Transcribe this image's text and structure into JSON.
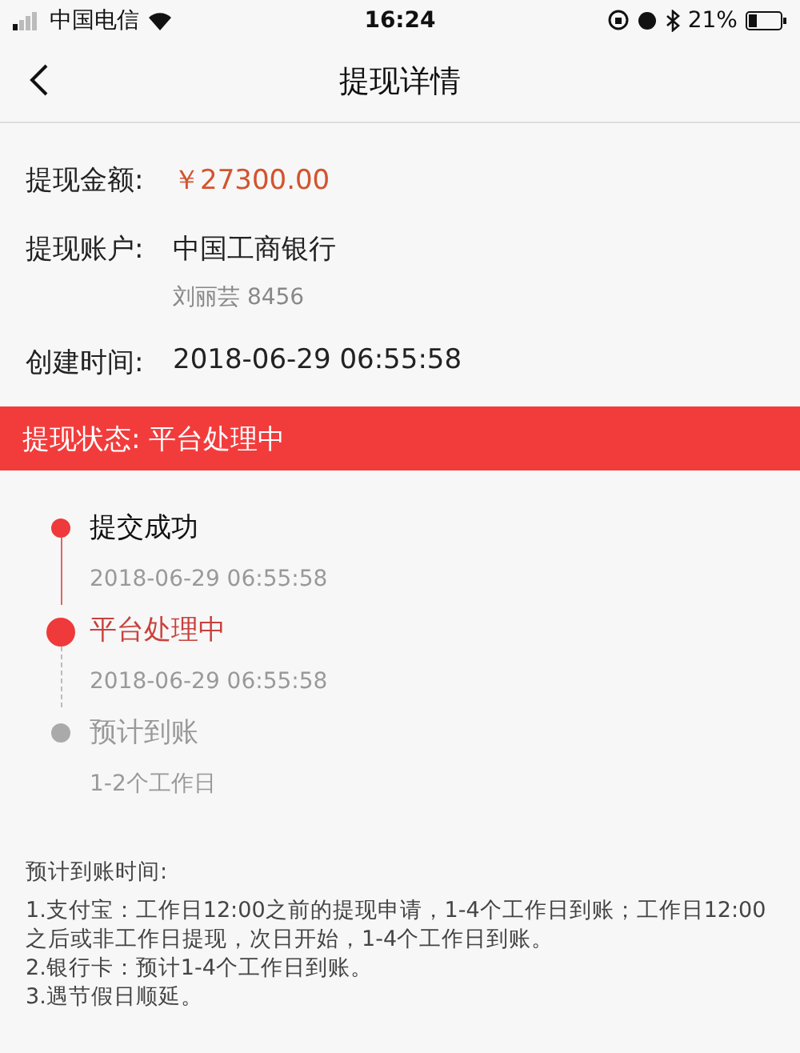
{
  "status_bar": {
    "carrier": "中国电信",
    "time": "16:24",
    "battery": "21%"
  },
  "nav": {
    "title": "提现详情"
  },
  "details": [
    {
      "label": "提现金额:",
      "value": "￥27300.00",
      "kind": "amount"
    },
    {
      "label": "提现账户:",
      "value": "中国工商银行",
      "sub": "刘丽芸 8456",
      "kind": "text"
    },
    {
      "label": "创建时间:",
      "value": "2018-06-29 06:55:58",
      "kind": "text"
    }
  ],
  "status_banner": "提现状态:  平台处理中",
  "timeline": [
    {
      "title": "提交成功",
      "time": "2018-06-29 06:55:58",
      "kind": "done"
    },
    {
      "title": "平台处理中",
      "time": "2018-06-29 06:55:58",
      "kind": "current"
    },
    {
      "title": "预计到账",
      "time": "1-2个工作日",
      "kind": "pending"
    }
  ],
  "notes": {
    "heading": "预计到账时间:",
    "items": [
      "1.支付宝：工作日12:00之前的提现申请，1-4个工作日到账；工作日12:00之后或非工作日提现，次日开始，1-4个工作日到账。",
      "2.银行卡：预计1-4个工作日到账。",
      "3.遇节假日顺延。"
    ]
  }
}
